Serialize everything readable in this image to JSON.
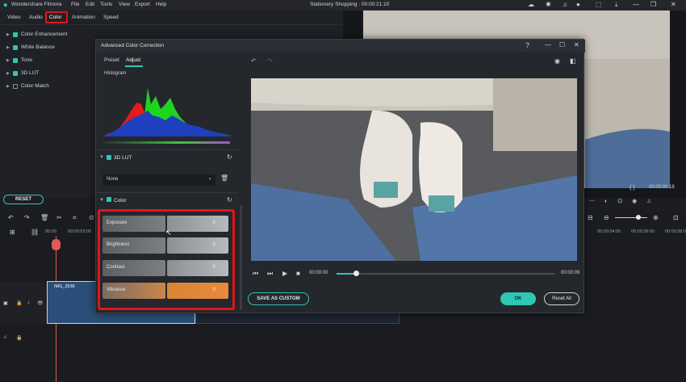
{
  "app": {
    "name": "Wondershare Filmora",
    "menu": [
      "File",
      "Edit",
      "Tools",
      "View",
      "Export",
      "Help"
    ],
    "project_title": "Stationery Shopping : 00:00:21:10"
  },
  "property_tabs": [
    "Video",
    "Audio",
    "Color",
    "Animation",
    "Speed"
  ],
  "property_items": [
    {
      "label": "Color Enhancement",
      "checked": true
    },
    {
      "label": "White Balance",
      "checked": true
    },
    {
      "label": "Tone",
      "checked": true
    },
    {
      "label": "3D LUT",
      "checked": true
    },
    {
      "label": "Color Match",
      "checked": false
    }
  ],
  "reset_label": "RESET",
  "timeline": {
    "ruler": [
      "00:00",
      "00:00:02:00",
      "00:00:34:00",
      "00:00:36:00",
      "00:00:38:0"
    ],
    "clip_label": "IMG_2536",
    "preview_time": "00:00:00:18"
  },
  "dialog": {
    "title": "Advanced Color Correction",
    "tabs": [
      "Preset",
      "Adjust"
    ],
    "active_tab": "Adjust",
    "histogram_label": "Histogram",
    "lut_section": "3D LUT",
    "lut_value": "None",
    "color_section": "Color",
    "sliders": [
      {
        "label": "Exposure",
        "value": "0"
      },
      {
        "label": "Brightness",
        "value": "0"
      },
      {
        "label": "Contrast",
        "value": "0"
      },
      {
        "label": "Vibrance",
        "value": "0"
      }
    ],
    "playback_time": "00:00:00",
    "duration": "00:00:09",
    "playback_progress": 0.09,
    "save_custom": "SAVE AS CUSTOM",
    "ok": "OK",
    "reset_all": "Reset All"
  },
  "colors": {
    "accent": "#2fc7b4",
    "highlight": "#e0151b",
    "vibrance": "#e88a3a"
  }
}
